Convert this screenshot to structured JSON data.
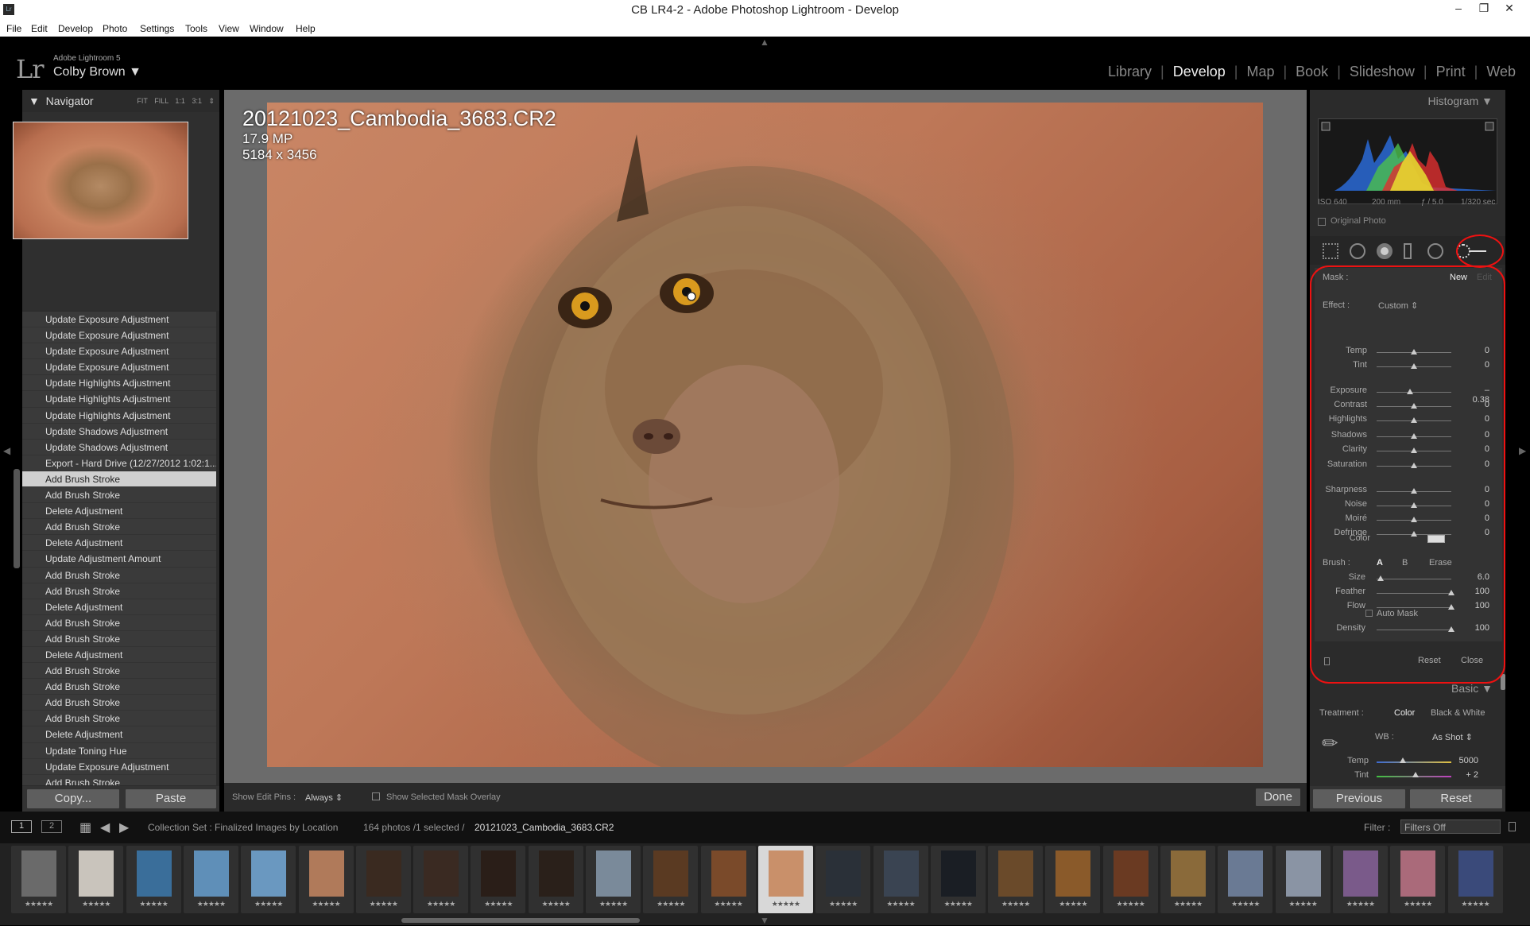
{
  "titlebar": {
    "app_icon": "Lr",
    "title": "CB LR4-2 - Adobe Photoshop Lightroom - Develop",
    "minimize": "–",
    "restore": "❐",
    "close": "✕"
  },
  "menu": [
    "File",
    "Edit",
    "Develop",
    "Photo",
    "Settings",
    "Tools",
    "View",
    "Window",
    "Help"
  ],
  "identity": {
    "logo": "Lr",
    "product": "Adobe Lightroom 5",
    "user": "Colby Brown ▼"
  },
  "modules": [
    "Library",
    "Develop",
    "Map",
    "Book",
    "Slideshow",
    "Print",
    "Web"
  ],
  "navigator": {
    "title": "Navigator",
    "options": "FIT FILL 1:1 3:1 ⇕"
  },
  "history": [
    "Update Exposure Adjustment",
    "Update Exposure Adjustment",
    "Update Exposure Adjustment",
    "Update Exposure Adjustment",
    "Update Highlights Adjustment",
    "Update Highlights Adjustment",
    "Update Highlights Adjustment",
    "Update Shadows Adjustment",
    "Update Shadows Adjustment",
    "Export - Hard Drive (12/27/2012 1:02:1...",
    "Add Brush Stroke",
    "Add Brush Stroke",
    "Delete Adjustment",
    "Add Brush Stroke",
    "Delete Adjustment",
    "Update Adjustment Amount",
    "Add Brush Stroke",
    "Add Brush Stroke",
    "Delete Adjustment",
    "Add Brush Stroke",
    "Add Brush Stroke",
    "Delete Adjustment",
    "Add Brush Stroke",
    "Add Brush Stroke",
    "Add Brush Stroke",
    "Add Brush Stroke",
    "Delete Adjustment",
    "Update Toning Hue",
    "Update Exposure Adjustment",
    "Add Brush Stroke"
  ],
  "selected_history_index": 10,
  "left_buttons": {
    "copy": "Copy...",
    "paste": "Paste"
  },
  "photo": {
    "filename": "20121023_Cambodia_3683.CR2",
    "megapixels": "17.9 MP",
    "dimensions": "5184 x 3456"
  },
  "toolbar": {
    "edit_pins_label": "Show Edit Pins :",
    "edit_pins_value": "Always ⇕",
    "mask_overlay": "Show Selected Mask Overlay",
    "done": "Done"
  },
  "histogram": {
    "title": "Histogram ▼",
    "iso": "ISO 640",
    "focal": "200 mm",
    "aperture": "ƒ / 5.0",
    "shutter": "1/320 sec",
    "original_photo": "Original Photo"
  },
  "mask": {
    "label": "Mask :",
    "new": "New",
    "edit": "Edit",
    "effect_label": "Effect :",
    "effect_value": "Custom ⇕"
  },
  "sliders": [
    {
      "label": "Temp",
      "value": "0",
      "pos": 0.5
    },
    {
      "label": "Tint",
      "value": "0",
      "pos": 0.5
    },
    {
      "label": "Exposure",
      "value": "– 0.38",
      "pos": 0.45
    },
    {
      "label": "Contrast",
      "value": "0",
      "pos": 0.5
    },
    {
      "label": "Highlights",
      "value": "0",
      "pos": 0.5
    },
    {
      "label": "Shadows",
      "value": "0",
      "pos": 0.5
    },
    {
      "label": "Clarity",
      "value": "0",
      "pos": 0.5
    },
    {
      "label": "Saturation",
      "value": "0",
      "pos": 0.5
    },
    {
      "label": "Sharpness",
      "value": "0",
      "pos": 0.5
    },
    {
      "label": "Noise",
      "value": "0",
      "pos": 0.5
    },
    {
      "label": "Moiré",
      "value": "0",
      "pos": 0.5
    },
    {
      "label": "Defringe",
      "value": "0",
      "pos": 0.5
    }
  ],
  "color_label": "Color",
  "brush": {
    "label": "Brush :",
    "a": "A",
    "b": "B",
    "erase": "Erase",
    "size_label": "Size",
    "size_value": "6.0",
    "size_pos": 0.05,
    "feather_label": "Feather",
    "feather_value": "100",
    "feather_pos": 1.0,
    "flow_label": "Flow",
    "flow_value": "100",
    "flow_pos": 1.0,
    "auto_mask": "Auto Mask",
    "density_label": "Density",
    "density_value": "100",
    "density_pos": 1.0
  },
  "panel_buttons": {
    "reset": "Reset",
    "close": "Close"
  },
  "basic": {
    "title": "Basic ▼",
    "treatment_label": "Treatment :",
    "color": "Color",
    "bw": "Black & White",
    "wb_label": "WB :",
    "wb_value": "As Shot ⇕",
    "temp_label": "Temp",
    "temp_value": "5000",
    "temp_pos": 0.35,
    "tint_label": "Tint",
    "tint_value": "+ 2",
    "tint_pos": 0.52
  },
  "right_buttons": {
    "previous": "Previous",
    "reset": "Reset"
  },
  "filmbar": {
    "page1": "1",
    "page2": "2",
    "collection": "Collection Set : Finalized Images by Location",
    "count": "164 photos /1 selected /",
    "current": "20121023_Cambodia_3683.CR2",
    "filter_label": "Filter :",
    "filter_value": "Filters Off"
  },
  "film_stars": "★★★★★",
  "film_count": 26,
  "film_selected_index": 13,
  "colors": {
    "accent_red": "#e11111",
    "panel_bg": "#2b2b2b",
    "center_bg": "#6b6b6b"
  }
}
